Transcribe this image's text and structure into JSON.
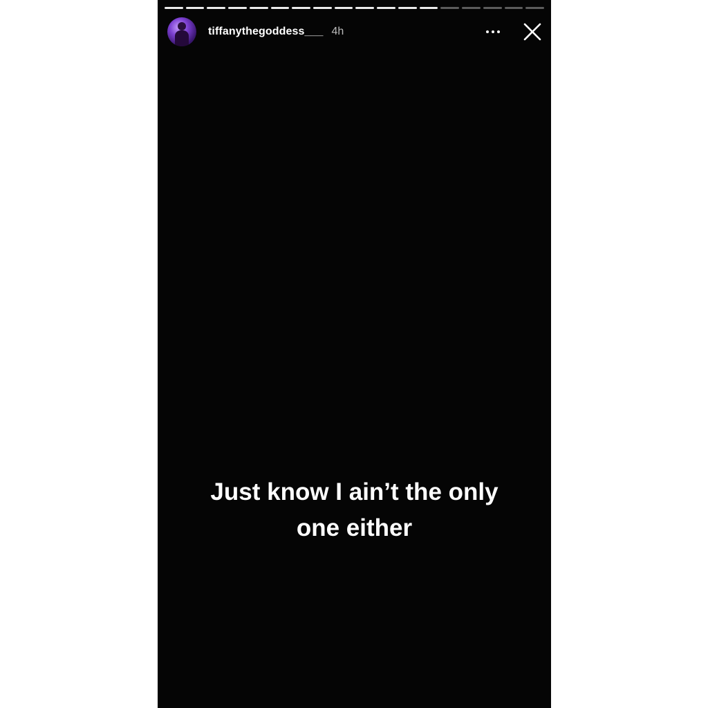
{
  "story": {
    "progress": {
      "total_segments": 18,
      "seen_segments": 13
    },
    "user": {
      "username": "tiffanythegoddess___",
      "time_ago": "4h",
      "avatar_icon": "profile-avatar"
    },
    "controls": {
      "more_icon": "more-horizontal-icon",
      "close_icon": "close-icon"
    },
    "caption": {
      "line1": "Just know I ain’t the only",
      "line2": "one either"
    },
    "colors": {
      "background": "#050505",
      "text": "#ffffff",
      "page": "#ffffff"
    }
  }
}
